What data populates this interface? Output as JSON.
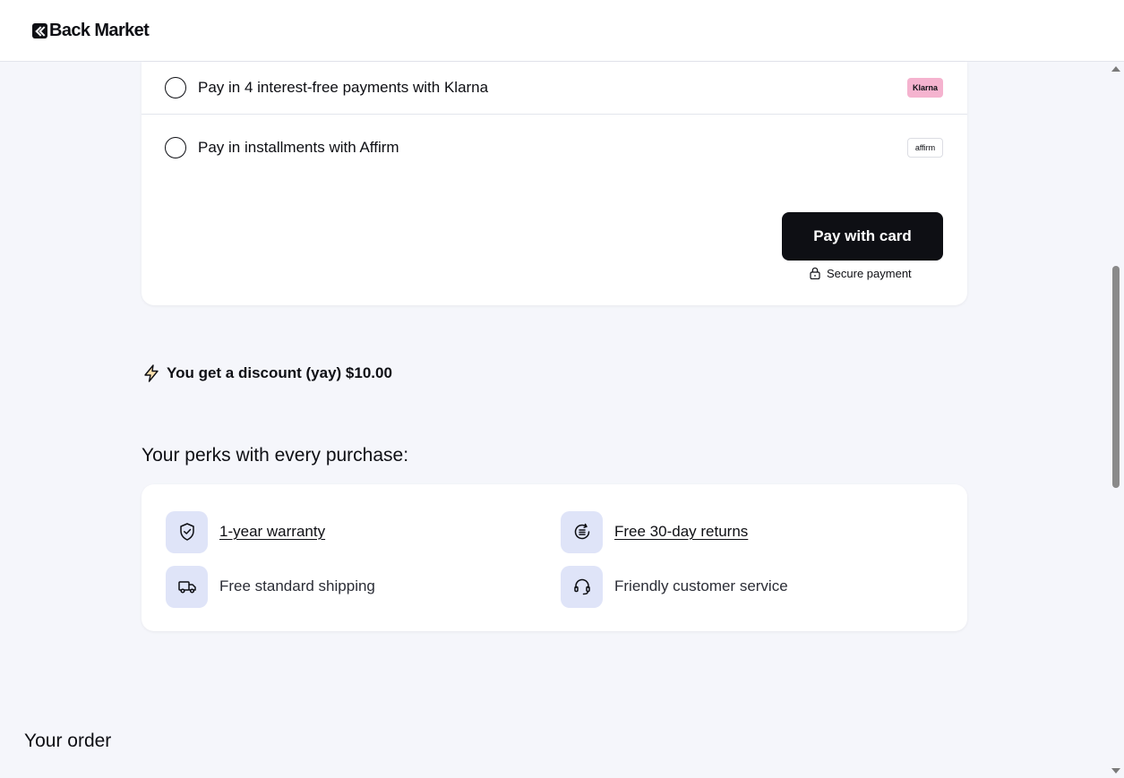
{
  "header": {
    "logo_text": "Back Market"
  },
  "payment": {
    "options": [
      {
        "label": "Pay in 4 interest-free payments with Klarna",
        "badge": "Klarna",
        "badge_color": "#f5b3cf"
      },
      {
        "label": "Pay in installments with Affirm",
        "badge": "affirm"
      }
    ],
    "pay_button_label": "Pay with card",
    "secure_text": "Secure payment"
  },
  "discount": {
    "text": "You get a discount (yay) $10.00",
    "icon": "lightning-icon"
  },
  "perks": {
    "title": "Your perks with every purchase:",
    "items": [
      {
        "label": "1-year warranty",
        "icon": "shield-check-icon",
        "link": true
      },
      {
        "label": "Free 30-day returns",
        "icon": "refresh-coins-icon",
        "link": true
      },
      {
        "label": "Free standard shipping",
        "icon": "truck-icon",
        "link": false
      },
      {
        "label": "Friendly customer service",
        "icon": "headset-icon",
        "link": false
      }
    ],
    "icon_bg_color": "#dfe4f8"
  },
  "order": {
    "title": "Your order"
  },
  "colors": {
    "background": "#f5f6fb",
    "primary_dark": "#0e0f14",
    "accent_bolt": "#f2a93b"
  }
}
